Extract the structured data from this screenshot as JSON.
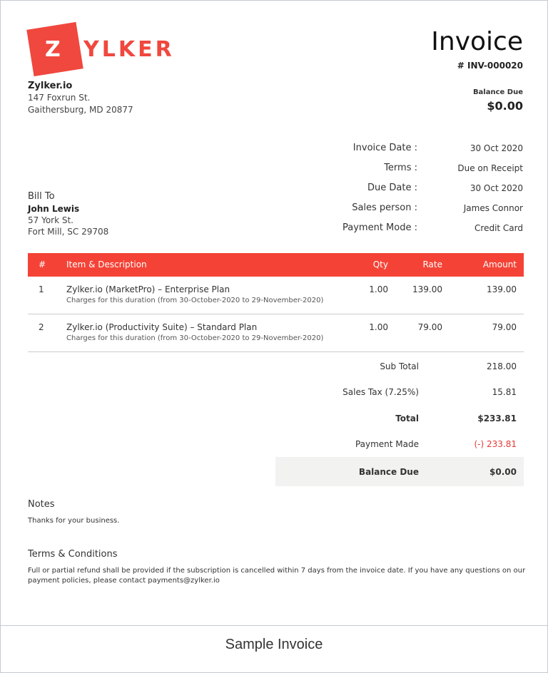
{
  "brand": {
    "logo_text": "ZYLKER",
    "color": "#f0483e"
  },
  "company": {
    "name": "Zylker.io",
    "address1": "147 Foxrun St.",
    "address2": "Gaithersburg, MD 20877"
  },
  "invoice": {
    "title": "Invoice",
    "number": "# INV-000020",
    "balance_label": "Balance Due",
    "balance": "$0.00"
  },
  "meta": [
    {
      "label": "Invoice Date :",
      "value": "30 Oct 2020"
    },
    {
      "label": "Terms :",
      "value": "Due on Receipt"
    },
    {
      "label": "Due Date :",
      "value": "30 Oct 2020"
    },
    {
      "label": "Sales person :",
      "value": "James Connor"
    },
    {
      "label": "Payment Mode :",
      "value": "Credit Card"
    }
  ],
  "bill_to": {
    "label": "Bill To",
    "name": "John Lewis",
    "address1": "57 York St.",
    "address2": "Fort Mill, SC 29708"
  },
  "table": {
    "headers": [
      "#",
      "Item & Description",
      "Qty",
      "Rate",
      "Amount"
    ],
    "rows": [
      {
        "num": "1",
        "item": "Zylker.io (MarketPro) – Enterprise Plan",
        "desc": "Charges for this duration (from 30-October-2020 to 29-November-2020)",
        "qty": "1.00",
        "rate": "139.00",
        "amount": "139.00"
      },
      {
        "num": "2",
        "item": "Zylker.io (Productivity Suite) – Standard Plan",
        "desc": "Charges for this duration (from 30-October-2020 to 29-November-2020)",
        "qty": "1.00",
        "rate": "79.00",
        "amount": "79.00"
      }
    ]
  },
  "totals": {
    "sub_total_label": "Sub Total",
    "sub_total": "218.00",
    "tax_label": "Sales Tax (7.25%)",
    "tax": "15.81",
    "total_label": "Total",
    "total": "$233.81",
    "payment_label": "Payment Made",
    "payment": "(-) 233.81",
    "balance_label": "Balance Due",
    "balance": "$0.00",
    "payment_color": "#e53935"
  },
  "notes": {
    "label": "Notes",
    "text": "Thanks for your business."
  },
  "terms": {
    "label": "Terms & Conditions",
    "line1": "Full or partial refund shall be provided if the subscription is cancelled within 7 days from the invoice date. If you have any questions on our",
    "line2": "payment policies, please contact payments@zylker.io"
  },
  "footer": {
    "caption": "Sample Invoice"
  }
}
